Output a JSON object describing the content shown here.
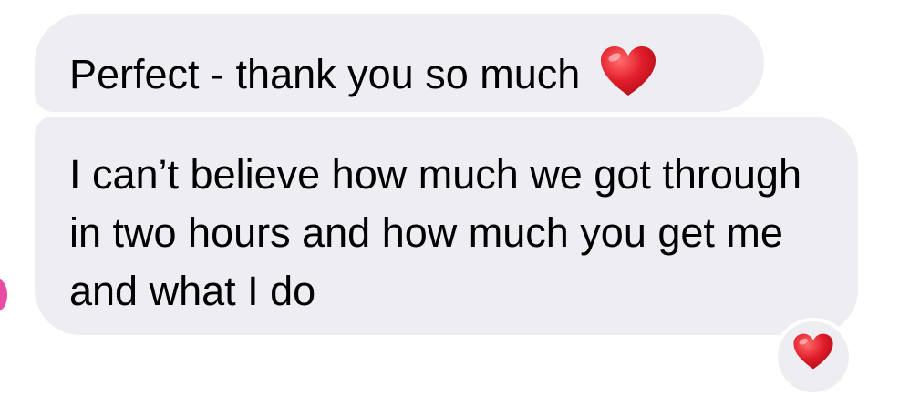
{
  "messages": [
    {
      "text": "Perfect - thank you so much",
      "emoji": "heart-icon"
    },
    {
      "text": "I can’t believe how much we got through in two hours and how much you get me and what I do"
    }
  ],
  "reaction": {
    "emoji": "heart-icon"
  },
  "colors": {
    "bubble": "#eeeef2",
    "heart": "#e11d2a",
    "avatar_ring": "#e94ca5",
    "background": "#ffffff"
  }
}
